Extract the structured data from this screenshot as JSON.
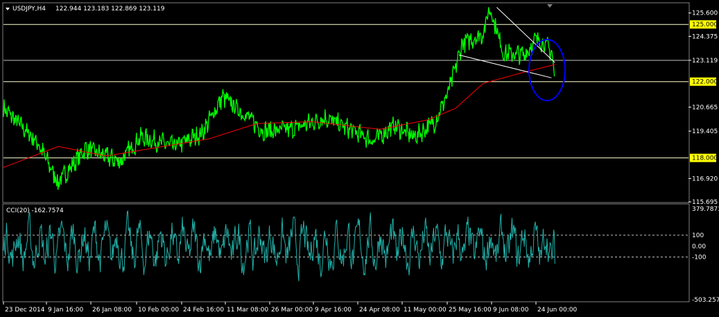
{
  "header": {
    "symbol": "USDJPY,H4",
    "ohlc": "122.944 123.183 122.869 123.119",
    "cci_label": "CCI(20) -162.7574"
  },
  "colors": {
    "background": "#000000",
    "price": "#00ff00",
    "ma": "#ff0000",
    "cci": "#20b2aa",
    "level_line": "#ffffd0",
    "level_label_bg": "#ffff00",
    "trendline": "#ffffff",
    "ellipse": "#0000ff"
  },
  "chart_data": [
    {
      "type": "line",
      "name": "price",
      "ylim": [
        115.695,
        126.1
      ],
      "yticks": [
        "125.600",
        "124.375",
        "123.119",
        "120.665",
        "119.405",
        "116.920",
        "115.695"
      ],
      "level_labels": [
        "125.000",
        "122.000",
        "118.000"
      ],
      "levels": [
        125.0,
        123.119,
        122.0,
        118.0
      ],
      "xticks": [
        "23 Dec 2014",
        "9 Jan 16:00",
        "26 Jan 08:00",
        "10 Feb 00:00",
        "24 Feb 16:00",
        "11 Mar 08:00",
        "26 Mar 00:00",
        "9 Apr 16:00",
        "24 Apr 08:00",
        "11 May 00:00",
        "25 May 16:00",
        "9 Jun 08:00",
        "24 Jun 00:00"
      ],
      "price_anchors": [
        [
          0,
          120.6
        ],
        [
          0.05,
          118.8
        ],
        [
          0.08,
          116.7
        ],
        [
          0.12,
          118.5
        ],
        [
          0.17,
          117.8
        ],
        [
          0.2,
          119.1
        ],
        [
          0.25,
          118.6
        ],
        [
          0.29,
          119.3
        ],
        [
          0.32,
          121.2
        ],
        [
          0.355,
          120.2
        ],
        [
          0.38,
          119.4
        ],
        [
          0.42,
          119.5
        ],
        [
          0.47,
          120.1
        ],
        [
          0.5,
          119.6
        ],
        [
          0.54,
          118.9
        ],
        [
          0.57,
          119.7
        ],
        [
          0.6,
          119.1
        ],
        [
          0.63,
          119.9
        ],
        [
          0.65,
          121.5
        ],
        [
          0.67,
          124.0
        ],
        [
          0.7,
          124.5
        ],
        [
          0.71,
          125.9
        ],
        [
          0.73,
          123.5
        ],
        [
          0.76,
          123.4
        ],
        [
          0.78,
          124.3
        ],
        [
          0.8,
          123.6
        ],
        [
          0.805,
          122.2
        ]
      ],
      "ma_anchors": [
        [
          0,
          117.5
        ],
        [
          0.08,
          118.6
        ],
        [
          0.15,
          118.1
        ],
        [
          0.2,
          118.4
        ],
        [
          0.3,
          119.0
        ],
        [
          0.37,
          119.8
        ],
        [
          0.45,
          119.9
        ],
        [
          0.55,
          119.5
        ],
        [
          0.62,
          120.0
        ],
        [
          0.66,
          120.6
        ],
        [
          0.7,
          121.9
        ],
        [
          0.75,
          122.4
        ],
        [
          0.805,
          122.9
        ]
      ],
      "trendlines": [
        [
          [
            0.72,
            125.9
          ],
          [
            0.805,
            123.0
          ]
        ],
        [
          [
            0.665,
            123.4
          ],
          [
            0.8,
            122.2
          ]
        ]
      ]
    },
    {
      "type": "line",
      "name": "CCI(20)",
      "ylim": [
        -503.2579,
        379.7873
      ],
      "yticks": [
        "379.7873",
        "100",
        "0.00",
        "-100",
        "-503.2579"
      ],
      "levels": [
        100,
        -100
      ],
      "last_value": -162.7574
    }
  ]
}
